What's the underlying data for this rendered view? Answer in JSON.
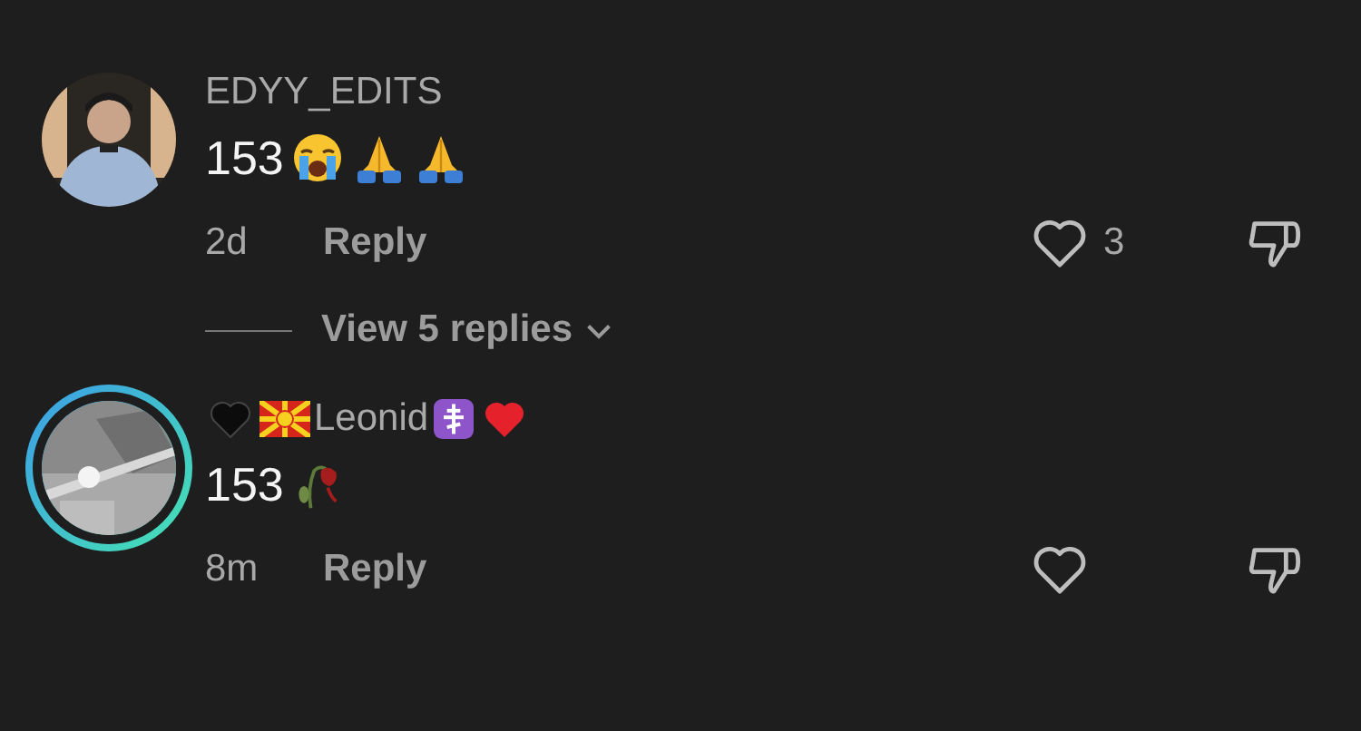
{
  "comments": [
    {
      "username": "EDYY_EDITS",
      "story_ring": false,
      "text": "153",
      "text_emojis": [
        {
          "kind": "crying"
        },
        {
          "kind": "praying"
        },
        {
          "kind": "praying"
        }
      ],
      "age": "2d",
      "reply": "Reply",
      "likes": "3",
      "replies": {
        "label": "View 5 replies"
      }
    },
    {
      "username": "Leonid",
      "story_ring": true,
      "name_prefix": [
        {
          "kind": "black-heart"
        },
        {
          "kind": "flag"
        }
      ],
      "name_suffix": [
        {
          "kind": "cross"
        },
        {
          "kind": "red-heart"
        }
      ],
      "text": "153",
      "text_emojis": [
        {
          "kind": "rose"
        }
      ],
      "age": "8m",
      "reply": "Reply"
    }
  ]
}
